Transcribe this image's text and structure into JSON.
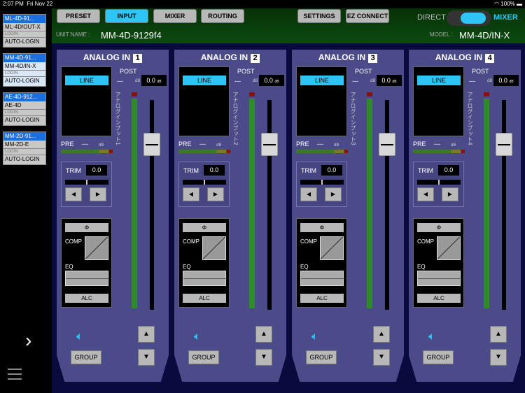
{
  "status": {
    "time": "2:07 PM",
    "date": "Fri Nov 22",
    "battery": "100%"
  },
  "sidebar": {
    "devices": [
      {
        "header": "ML-4D-91...",
        "model": "ML-4D/OUT-X",
        "login": "LOGIN",
        "autologin": "AUTO-LOGIN",
        "selected": false
      },
      {
        "header": "MM-4D-91...",
        "model": "MM-4D/IN-X",
        "login": "LOGIN",
        "autologin": "AUTO-LOGIN",
        "selected": true
      },
      {
        "header": "AE-4D-912...",
        "model": "AE-4D",
        "login": "LOGIN",
        "autologin": "AUTO-LOGIN",
        "selected": false
      },
      {
        "header": "MM-2D-91...",
        "model": "MM-2D-E",
        "login": "LOGIN",
        "autologin": "AUTO-LOGIN",
        "selected": false
      }
    ]
  },
  "toolbar": {
    "preset": "PRESET",
    "input": "INPUT",
    "mixer": "MIXER",
    "routing": "ROUTING",
    "settings": "SETTINGS",
    "ez_connect": "EZ CONNECT",
    "direct": "DIRECT",
    "mixer_toggle": "MIXER"
  },
  "unit": {
    "label": "UNIT NAME :",
    "value": "MM-4D-9129f4",
    "model_label": "MODEL :",
    "model_value": "MM-4D/IN-X"
  },
  "channels": [
    {
      "title": "ANALOG IN",
      "num": "1",
      "line": "LINE",
      "post": "POST",
      "post_dash": "---",
      "post_val": "0.0",
      "db": "dB",
      "pre": "PRE",
      "pre_dash": "---",
      "vtext": "アナログインプット1",
      "trim_label": "TRIM",
      "trim_val": "0.0",
      "phase": "Φ",
      "comp": "COMP",
      "eq": "EQ",
      "alc": "ALC",
      "group": "GROUP"
    },
    {
      "title": "ANALOG IN",
      "num": "2",
      "line": "LINE",
      "post": "POST",
      "post_dash": "---",
      "post_val": "0.0",
      "db": "dB",
      "pre": "PRE",
      "pre_dash": "---",
      "vtext": "アナログインプット2",
      "trim_label": "TRIM",
      "trim_val": "0.0",
      "phase": "Φ",
      "comp": "COMP",
      "eq": "EQ",
      "alc": "ALC",
      "group": "GROUP"
    },
    {
      "title": "ANALOG IN",
      "num": "3",
      "line": "LINE",
      "post": "POST",
      "post_dash": "---",
      "post_val": "0.0",
      "db": "dB",
      "pre": "PRE",
      "pre_dash": "---",
      "vtext": "アナログインプット3",
      "trim_label": "TRIM",
      "trim_val": "0.0",
      "phase": "Φ",
      "comp": "COMP",
      "eq": "EQ",
      "alc": "ALC",
      "group": "GROUP"
    },
    {
      "title": "ANALOG IN",
      "num": "4",
      "line": "LINE",
      "post": "POST",
      "post_dash": "---",
      "post_val": "0.0",
      "db": "dB",
      "pre": "PRE",
      "pre_dash": "---",
      "vtext": "アナログインプット4",
      "trim_label": "TRIM",
      "trim_val": "0.0",
      "phase": "Φ",
      "comp": "COMP",
      "eq": "EQ",
      "alc": "ALC",
      "group": "GROUP"
    }
  ]
}
